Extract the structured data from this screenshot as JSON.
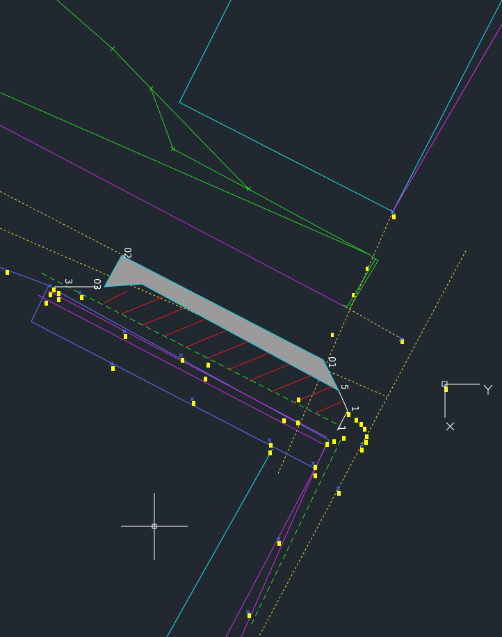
{
  "colors": {
    "background": "#212830",
    "cyan": "#1fc7d6",
    "green": "#2bd12b",
    "magenta": "#c12ed6",
    "yellow": "#e8e13a",
    "red": "#e01b1b",
    "blue": "#5a6ff0",
    "gray_fill": "#9b9b9b",
    "white": "#ffffff",
    "point_marker": "#ffff00"
  },
  "labels": {
    "vertex_02": "02",
    "vertex_03": "03",
    "vertex_01": "01",
    "point_3": "3",
    "point_5": "5",
    "point_1a": "1",
    "point_1b": "1"
  },
  "ucs_icon": {
    "x_axis": "X",
    "y_axis": "Y"
  },
  "crosshair_icon": "crosshair-cursor-icon"
}
